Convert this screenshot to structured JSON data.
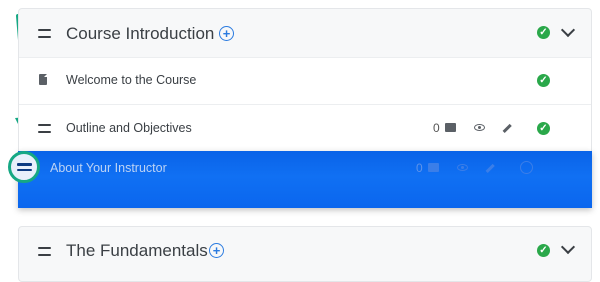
{
  "sections": [
    {
      "title": "Course Introduction",
      "lessons": [
        {
          "title": "Welcome to the Course",
          "icon": "document-icon"
        },
        {
          "title": "Outline and Objectives",
          "icon": "drag-handle-icon",
          "comment_count": "0"
        }
      ]
    },
    {
      "title": "The Fundamentals"
    }
  ],
  "dragging": {
    "title": "About Your Instructor",
    "comment_count": "0"
  },
  "colors": {
    "accent": "#0a66ee",
    "complete": "#2aa84a",
    "annotation": "#16a884",
    "add": "#2b7be0"
  }
}
